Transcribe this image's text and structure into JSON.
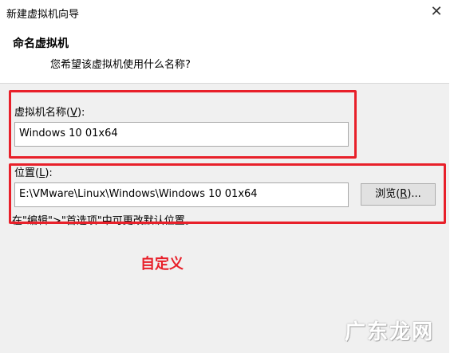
{
  "window": {
    "title": "新建虚拟机向导",
    "close_glyph": "✕"
  },
  "header": {
    "title": "命名虚拟机",
    "subtitle": "您希望该虚拟机使用什么名称?"
  },
  "name_field": {
    "label_prefix": "虚拟机名称(",
    "label_key": "V",
    "label_suffix": "):",
    "value": "Windows 10 01x64"
  },
  "location_field": {
    "label_prefix": "位置(",
    "label_key": "L",
    "label_suffix": "):",
    "value": "E:\\VMware\\Linux\\Windows\\Windows 10 01x64"
  },
  "browse_button": {
    "label_prefix": "浏览(",
    "label_key": "R",
    "label_suffix": ")..."
  },
  "hint": "在\"编辑\">\"首选项\"中可更改默认位置。",
  "annotation": "自定义",
  "watermark": "广东龙网",
  "colors": {
    "highlight": "#e8202a"
  }
}
